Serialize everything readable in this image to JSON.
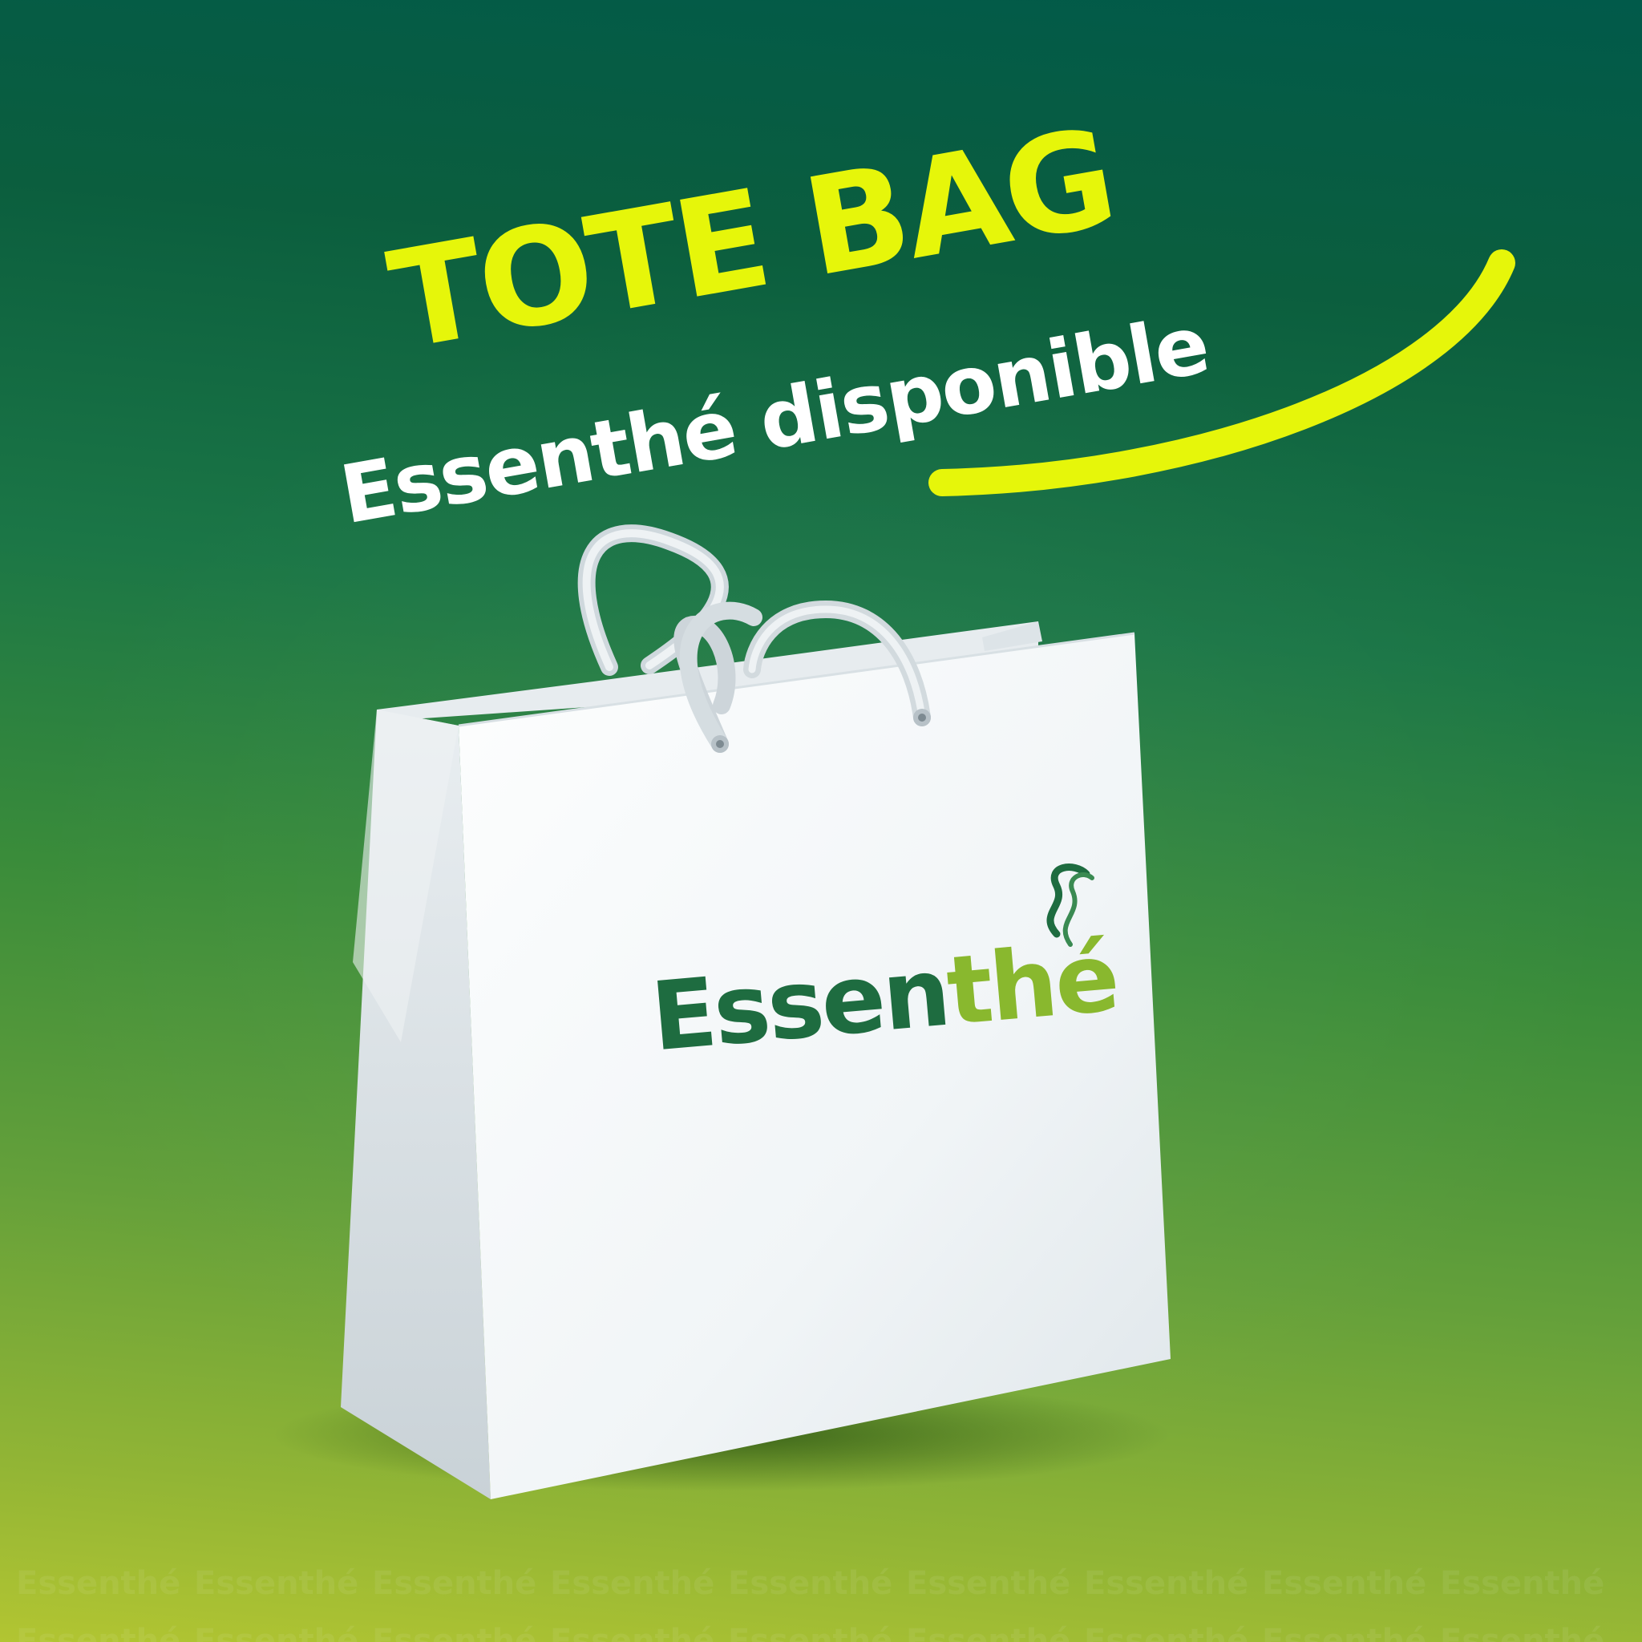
{
  "headline": "TOTE BAG",
  "subheadline": "Essenthé disponible",
  "bag_logo": {
    "part1": "Essen",
    "part2": "thé"
  },
  "watermark_text": "Essenthé",
  "colors": {
    "accent_yellow": "#e6f60a",
    "brand_dark_green": "#1e6c40",
    "brand_light_green": "#89b82e",
    "background_top": "#015a4a",
    "background_bottom": "#b2c532"
  },
  "icons": {
    "steam": "steam-swirl-icon"
  }
}
